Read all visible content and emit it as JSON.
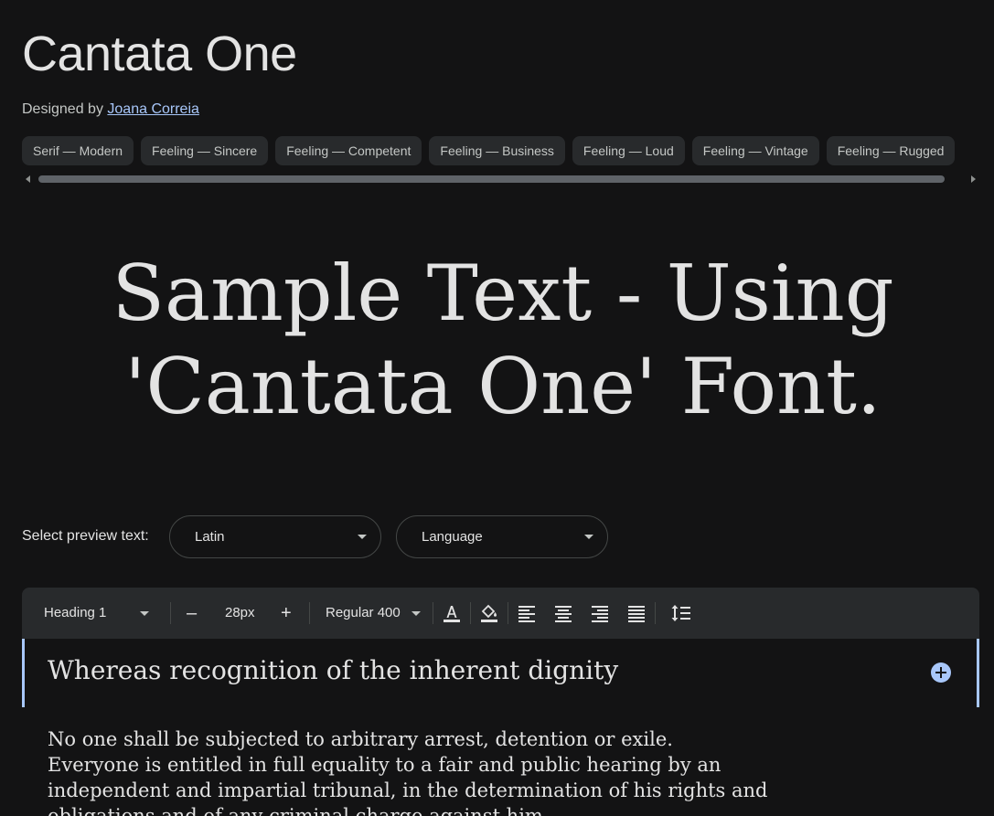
{
  "font": {
    "title": "Cantata One",
    "designed_by_label": "Designed by",
    "designer": "Joana Correia"
  },
  "tags": [
    "Serif — Modern",
    "Feeling — Sincere",
    "Feeling — Competent",
    "Feeling — Business",
    "Feeling — Loud",
    "Feeling — Vintage",
    "Feeling — Rugged"
  ],
  "sample": {
    "line1": "Sample Text - Using",
    "line2": "'Cantata One' Font."
  },
  "preview": {
    "label": "Select preview text:",
    "script_value": "Latin",
    "language_value": "Language"
  },
  "toolbar": {
    "style_value": "Heading 1",
    "minus": "–",
    "size_value": "28px",
    "plus": "+",
    "weight_value": "Regular 400"
  },
  "editor": {
    "heading": "Whereas recognition of the inherent dignity"
  },
  "body_lines": [
    "No one shall be subjected to arbitrary arrest, detention or exile.",
    "Everyone is entitled in full equality to a fair and public hearing by an",
    "independent and impartial tribunal, in the determination of his rights and",
    "obligations and of any criminal charge against him."
  ],
  "icons": {
    "text_color": "text-color-icon",
    "fill_color": "fill-color-icon",
    "align_left": "align-left-icon",
    "align_center": "align-center-icon",
    "align_right": "align-right-icon",
    "align_justify": "align-justify-icon",
    "line_height": "line-height-icon",
    "add": "add-circle-icon"
  },
  "colors": {
    "background": "#131314",
    "surface": "#282a2c",
    "accent": "#a8c7fa",
    "text": "#e3e3e3"
  }
}
